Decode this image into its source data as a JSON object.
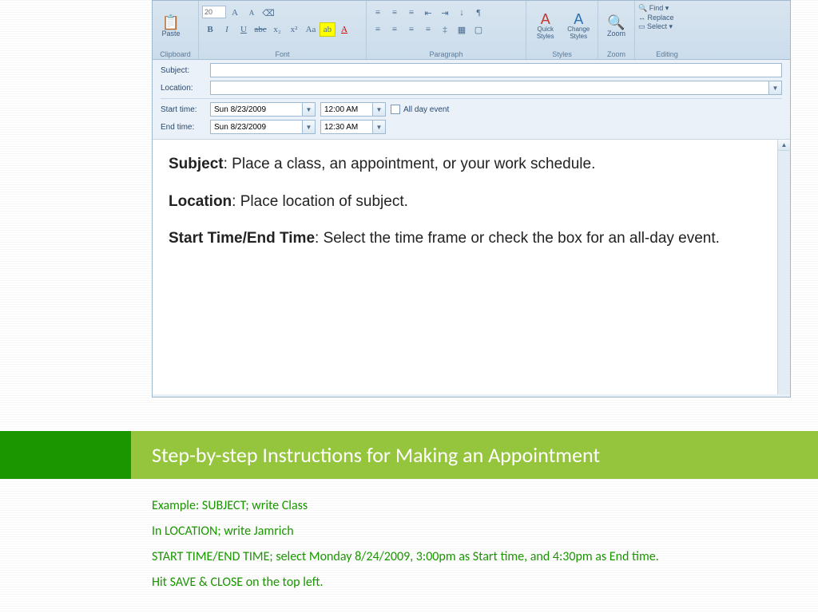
{
  "ribbon": {
    "clipboard": {
      "paste": "Paste",
      "label": "Clipboard"
    },
    "font": {
      "size": "20",
      "label": "Font"
    },
    "paragraph": {
      "label": "Paragraph"
    },
    "styles": {
      "quick": "Quick Styles",
      "change": "Change Styles",
      "label": "Styles"
    },
    "zoom": {
      "zoom": "Zoom",
      "label": "Zoom"
    },
    "editing": {
      "find": "Find",
      "replace": "Replace",
      "select": "Select",
      "label": "Editing"
    }
  },
  "form": {
    "subject_label": "Subject:",
    "location_label": "Location:",
    "start_label": "Start time:",
    "end_label": "End time:",
    "start_date": "Sun 8/23/2009",
    "start_time": "12:00 AM",
    "end_date": "Sun 8/23/2009",
    "end_time": "12:30 AM",
    "allday_label": "All day event"
  },
  "body": {
    "subject_b": "Subject",
    "subject_t": ": Place a class, an appointment, or your work schedule.",
    "location_b": "Location",
    "location_t": ": Place location of subject.",
    "time_b": "Start Time/End Time",
    "time_t": ": Select the time frame or check the box for an all-day event."
  },
  "title": "Step-by-step Instructions for Making an Appointment",
  "example": {
    "l1": "Example: SUBJECT; write Class",
    "l2": "In LOCATION; write Jamrich",
    "l3": "START TIME/END TIME; select Monday 8/24/2009, 3:00pm as Start time, and 4:30pm as End time.",
    "l4": "Hit SAVE & CLOSE on the top left."
  }
}
